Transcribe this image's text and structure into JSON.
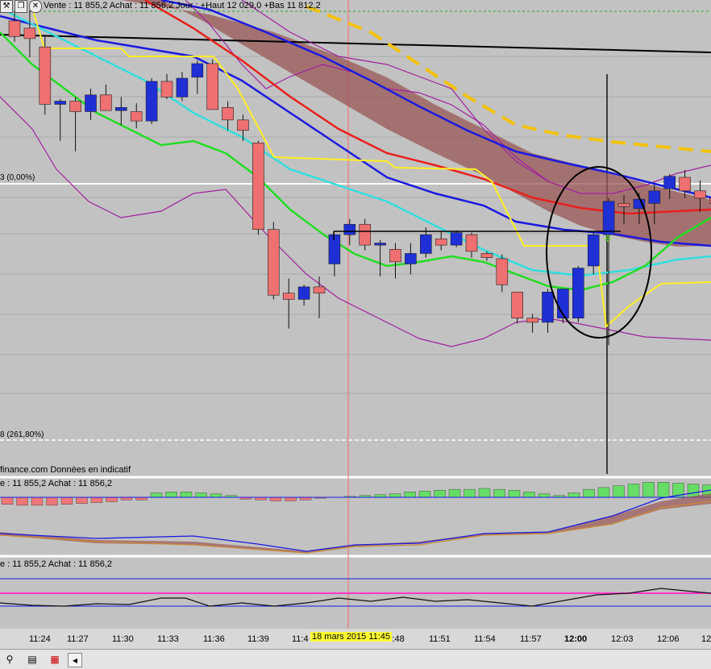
{
  "header": {
    "quote_text": "Vente : 11 855,2 Achat : 11 856,2 Jour : +Haut 12 029,0 +Bas 11 812,2"
  },
  "toolbar_icons": [
    "wrench-icon",
    "window-icon",
    "close-icon"
  ],
  "fib_labels": {
    "level_0": "3 (0,00%)",
    "level_261": "8 (261,80%)"
  },
  "source_note": "finance.com Données en indicatif",
  "panel2_label": "e : 11 855,2 Achat : 11 856,2",
  "panel3_label": "e : 11 855,2 Achat : 11 856,2",
  "crosshair_time": "18 mars 2015 11:45",
  "bottom_icons": [
    "link-icon",
    "list-icon",
    "settings-icon",
    "scroll-left-icon"
  ],
  "colors": {
    "up_candle": "#1f2fd6",
    "down_candle": "#ee7070",
    "ema_red": "#e8201c",
    "ema_blue": "#1a1ae0",
    "ema_green": "#22dd22",
    "ema_cyan": "#33dddd",
    "yellow_line": "#ffee22",
    "dashed_orange": "#f2c20c",
    "band_purple": "#a020a0",
    "cloud_fill": "#9a5555",
    "macd_up": "#66dd66",
    "macd_down": "#ee7777",
    "stoch_magenta": "#ff33cc",
    "crosshair_red": "#ff6666"
  },
  "chart_data": {
    "type": "candlestick",
    "instrument_quote": {
      "vente": "11 855,2",
      "achat": "11 856,2",
      "jour_haut": "12 029,0",
      "jour_bas": "11 812,2"
    },
    "x_ticks": [
      "11:24",
      "11:27",
      "11:30",
      "11:33",
      "11:36",
      "11:39",
      "11:42",
      "11:45",
      "11:48",
      "11:51",
      "11:54",
      "11:57",
      "12:00",
      "12:03",
      "12:06",
      "12:0"
    ],
    "x_tick_labels_shown": [
      "11:24",
      "11:27",
      "11:30",
      "11:33",
      "11:36",
      "11:39",
      "11:4",
      "11:48",
      "11:51",
      "11:54",
      "11:57",
      "12:00",
      "12:03",
      "12:06",
      "12"
    ],
    "bold_tick": "12:00",
    "candles": [
      {
        "o": 11895,
        "h": 11905,
        "l": 11875,
        "c": 11880
      },
      {
        "o": 11888,
        "h": 11905,
        "l": 11860,
        "c": 11878
      },
      {
        "o": 11870,
        "h": 11880,
        "l": 11805,
        "c": 11815
      },
      {
        "o": 11815,
        "h": 11820,
        "l": 11780,
        "c": 11818
      },
      {
        "o": 11818,
        "h": 11822,
        "l": 11770,
        "c": 11808
      },
      {
        "o": 11808,
        "h": 11830,
        "l": 11800,
        "c": 11824
      },
      {
        "o": 11824,
        "h": 11834,
        "l": 11810,
        "c": 11809
      },
      {
        "o": 11809,
        "h": 11822,
        "l": 11795,
        "c": 11812
      },
      {
        "o": 11808,
        "h": 11816,
        "l": 11792,
        "c": 11799
      },
      {
        "o": 11799,
        "h": 11840,
        "l": 11796,
        "c": 11837
      },
      {
        "o": 11837,
        "h": 11844,
        "l": 11820,
        "c": 11822
      },
      {
        "o": 11822,
        "h": 11846,
        "l": 11818,
        "c": 11840
      },
      {
        "o": 11841,
        "h": 11857,
        "l": 11825,
        "c": 11854
      },
      {
        "o": 11854,
        "h": 11858,
        "l": 11810,
        "c": 11810
      },
      {
        "o": 11812,
        "h": 11818,
        "l": 11790,
        "c": 11800
      },
      {
        "o": 11800,
        "h": 11805,
        "l": 11780,
        "c": 11790
      },
      {
        "o": 11778,
        "h": 11780,
        "l": 11690,
        "c": 11695
      },
      {
        "o": 11695,
        "h": 11702,
        "l": 11628,
        "c": 11632
      },
      {
        "o": 11634,
        "h": 11648,
        "l": 11600,
        "c": 11628
      },
      {
        "o": 11628,
        "h": 11642,
        "l": 11622,
        "c": 11640
      },
      {
        "o": 11640,
        "h": 11650,
        "l": 11610,
        "c": 11634
      },
      {
        "o": 11662,
        "h": 11676,
        "l": 11650,
        "c": 11690
      },
      {
        "o": 11690,
        "h": 11705,
        "l": 11680,
        "c": 11700
      },
      {
        "o": 11700,
        "h": 11705,
        "l": 11675,
        "c": 11680
      },
      {
        "o": 11680,
        "h": 11685,
        "l": 11650,
        "c": 11682
      },
      {
        "o": 11676,
        "h": 11682,
        "l": 11648,
        "c": 11664
      },
      {
        "o": 11662,
        "h": 11682,
        "l": 11652,
        "c": 11672
      },
      {
        "o": 11672,
        "h": 11697,
        "l": 11668,
        "c": 11690
      },
      {
        "o": 11686,
        "h": 11693,
        "l": 11675,
        "c": 11680
      },
      {
        "o": 11680,
        "h": 11694,
        "l": 11678,
        "c": 11692
      },
      {
        "o": 11690,
        "h": 11692,
        "l": 11668,
        "c": 11674
      },
      {
        "o": 11672,
        "h": 11674,
        "l": 11665,
        "c": 11668
      },
      {
        "o": 11667,
        "h": 11671,
        "l": 11635,
        "c": 11642
      },
      {
        "o": 11635,
        "h": 11635,
        "l": 11605,
        "c": 11610
      },
      {
        "o": 11610,
        "h": 11614,
        "l": 11596,
        "c": 11606
      },
      {
        "o": 11606,
        "h": 11638,
        "l": 11596,
        "c": 11635
      },
      {
        "o": 11610,
        "h": 11614,
        "l": 11605,
        "c": 11638
      },
      {
        "o": 11610,
        "h": 11660,
        "l": 11606,
        "c": 11658
      },
      {
        "o": 11660,
        "h": 11692,
        "l": 11652,
        "c": 11690
      },
      {
        "o": 11690,
        "h": 11725,
        "l": 11584,
        "c": 11722
      },
      {
        "o": 11720,
        "h": 11728,
        "l": 11700,
        "c": 11717
      },
      {
        "o": 11715,
        "h": 11730,
        "l": 11700,
        "c": 11724
      },
      {
        "o": 11720,
        "h": 11738,
        "l": 11700,
        "c": 11732
      },
      {
        "o": 11734,
        "h": 11748,
        "l": 11724,
        "c": 11746
      },
      {
        "o": 11745,
        "h": 11752,
        "l": 11725,
        "c": 11732
      },
      {
        "o": 11732,
        "h": 11742,
        "l": 11712,
        "c": 11725
      },
      {
        "o": 11725,
        "h": 11735,
        "l": 11700,
        "c": 11720
      }
    ],
    "annotations": [
      "ellipse around 12:00 breakout",
      "horizontal resistance line ~11:42 to 12:02",
      "vertical cursor at 12:02"
    ],
    "subpanels": [
      "MACD histogram with signal lines",
      "oscillator with magenta reference line"
    ]
  }
}
